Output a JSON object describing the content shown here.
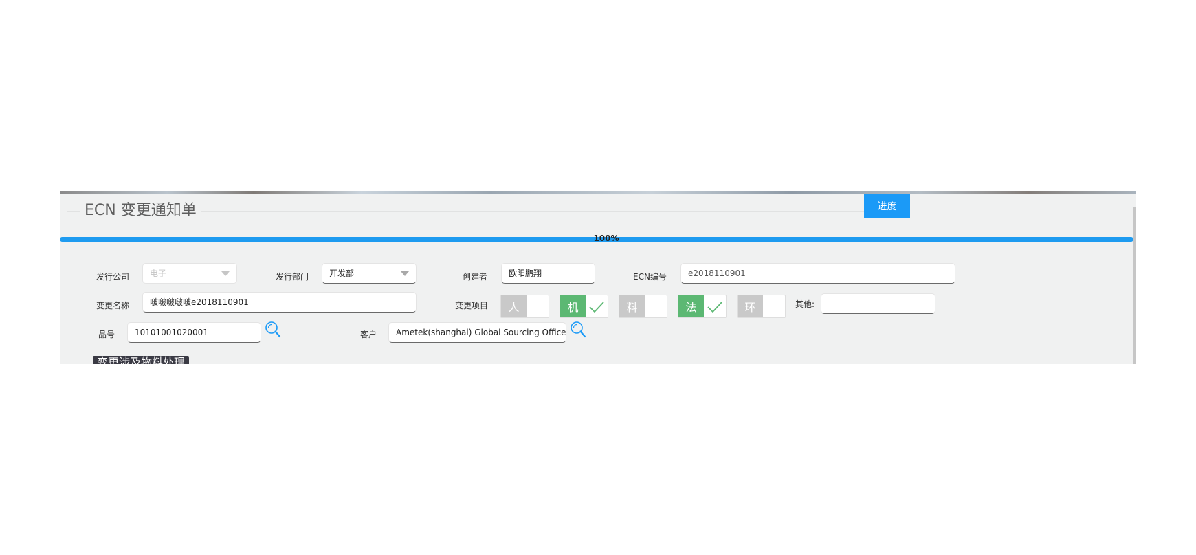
{
  "form": {
    "title": "ECN 变更通知单",
    "progress_button": "进度",
    "progress": {
      "value": 100,
      "label": "100%"
    },
    "company": {
      "label": "发行公司",
      "value": "电子"
    },
    "department": {
      "label": "发行部门",
      "value": "开发部"
    },
    "creator": {
      "label": "创建者",
      "value": "欧阳鹏翔"
    },
    "ecn_number": {
      "label": "ECN编号",
      "value": "e2018110901"
    },
    "change_name": {
      "label": "变更名称",
      "value": "啵啵啵啵啵e2018110901"
    },
    "change_items": {
      "label": "变更项目",
      "items": [
        {
          "letter": "人",
          "checked": false
        },
        {
          "letter": "机",
          "checked": true
        },
        {
          "letter": "料",
          "checked": false
        },
        {
          "letter": "法",
          "checked": true
        },
        {
          "letter": "环",
          "checked": false
        }
      ]
    },
    "other": {
      "label": "其他:",
      "value": ""
    },
    "part_number": {
      "label": "品号",
      "value": "10101001020001"
    },
    "customer": {
      "label": "客户",
      "value": "Ametek(shanghai) Global Sourcing Office"
    },
    "section_title": "变更涉及物料处理"
  },
  "colors": {
    "accent_blue": "#1b9af7",
    "toggle_on": "#5cb873",
    "toggle_off": "#c9c9c9",
    "panel_bg": "#f0f1f1"
  },
  "icons": {
    "search": "search-icon",
    "check": "check-icon"
  }
}
